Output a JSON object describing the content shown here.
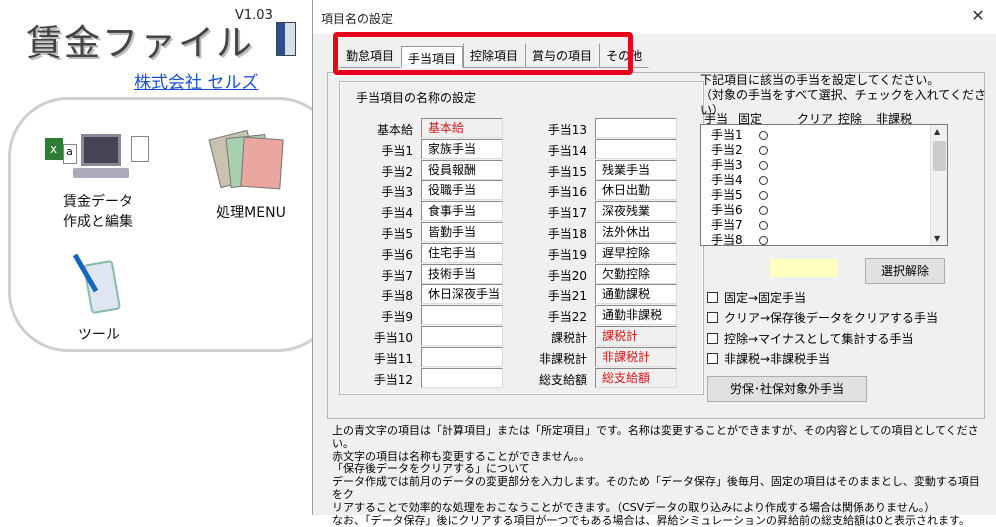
{
  "app": {
    "title": "賃金ファイル",
    "version": "V1.03",
    "company": "株式会社 セルズ",
    "launcher": [
      {
        "label_lines": [
          "賃金データ",
          "作成と編集"
        ]
      },
      {
        "label_lines": [
          "処理MENU"
        ]
      },
      {
        "label_lines": [
          "ツール"
        ]
      }
    ]
  },
  "dialog": {
    "title": "項目名の設定",
    "tabs": [
      "勤怠項目",
      "手当項目",
      "控除項目",
      "賞与の項目",
      "その他"
    ],
    "active_tab": 1,
    "group_title": "手当項目の名称の設定",
    "left_rows": [
      {
        "label": "基本給",
        "value": "基本給",
        "readonly": true
      },
      {
        "label": "手当1",
        "value": "家族手当"
      },
      {
        "label": "手当2",
        "value": "役員報酬"
      },
      {
        "label": "手当3",
        "value": "役職手当"
      },
      {
        "label": "手当4",
        "value": "食事手当"
      },
      {
        "label": "手当5",
        "value": "皆勤手当"
      },
      {
        "label": "手当6",
        "value": "住宅手当"
      },
      {
        "label": "手当7",
        "value": "技術手当"
      },
      {
        "label": "手当8",
        "value": "休日深夜手当"
      },
      {
        "label": "手当9",
        "value": ""
      },
      {
        "label": "手当10",
        "value": ""
      },
      {
        "label": "手当11",
        "value": ""
      },
      {
        "label": "手当12",
        "value": ""
      }
    ],
    "mid_rows": [
      {
        "label": "手当13",
        "value": ""
      },
      {
        "label": "手当14",
        "value": ""
      },
      {
        "label": "手当15",
        "value": "残業手当"
      },
      {
        "label": "手当16",
        "value": "休日出勤"
      },
      {
        "label": "手当17",
        "value": "深夜残業"
      },
      {
        "label": "手当18",
        "value": "法外休出"
      },
      {
        "label": "手当19",
        "value": "遅早控除"
      },
      {
        "label": "手当20",
        "value": "欠勤控除"
      },
      {
        "label": "手当21",
        "value": "通勤課税"
      },
      {
        "label": "手当22",
        "value": "通勤非課税"
      },
      {
        "label": "課税計",
        "value": "課税計",
        "readonly": true
      },
      {
        "label": "非課税計",
        "value": "非課税計",
        "readonly": true
      },
      {
        "label": "総支給額",
        "value": "総支給額",
        "readonly": true
      }
    ],
    "right_instruction": [
      "下記項目に該当の手当を設定してください。",
      "（対象の手当をすべて選択、チェックを入れてください）"
    ],
    "list_headers": [
      "手当",
      "固定",
      "クリア",
      "控除",
      "非課税"
    ],
    "list_items": [
      "手当1",
      "手当2",
      "手当3",
      "手当4",
      "手当5",
      "手当6",
      "手当7",
      "手当8"
    ],
    "deselect_button": "選択解除",
    "checkboxes": [
      "固定→固定手当",
      "クリア→保存後データをクリアする手当",
      "控除→マイナスとして集計する手当",
      "非課税→非課税手当"
    ],
    "insurance_button": "労保･社保対象外手当",
    "notes": [
      "上の青文字の項目は「計算項目」または「所定項目」です。名称は変更することができますが、その内容としての項目としてください。",
      "赤文字の項目は名称も変更することができません。。",
      "「保存後データをクリアする」について",
      "データ作成では前月のデータの変更部分を入力します。そのため「データ保存」後毎月、固定の項目はそのままとし、変動する項目をク",
      "リアすることで効率的な処理をおこなうことができます。（CSVデータの取り込みにより作成する場合は関係ありません。）",
      "なお、「データ保存」後にクリアする項目が一つでもある場合は、昇給シミュレーションの昇給前の総支給額は0と表示されます。"
    ]
  }
}
